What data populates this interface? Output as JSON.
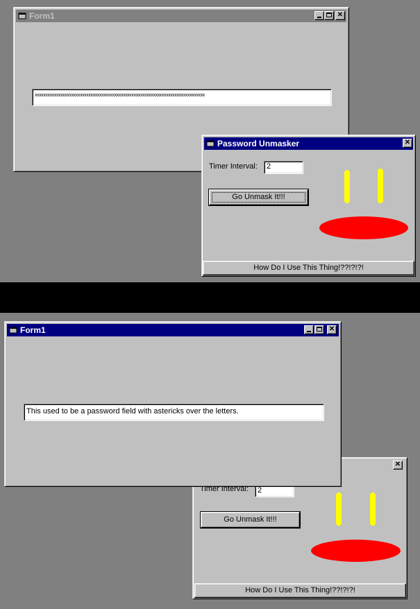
{
  "top_scene": {
    "form1": {
      "title": "Form1",
      "textbox_value": "xxxxxxxxxxxxxxxxxxxxxxxxxxxxxxxxxxxxxxxxxxxxxxxxxxxxxxxxxxxxxxxxxxxxxxxxxxxxxxx",
      "icons": {
        "app": "window-icon",
        "minimize": "minimize-icon",
        "maximize": "maximize-icon",
        "close": "close-icon"
      }
    },
    "unmasker": {
      "title": "Password Unmasker",
      "timer_label": "Timer Interval:",
      "timer_value": "2",
      "go_button": "Go Unmask It!!!",
      "help_button": "How Do I Use This Thing!??!?!?!",
      "close_icon": "close-icon"
    }
  },
  "bottom_scene": {
    "form1": {
      "title": "Form1",
      "textbox_value": "This used to be a password field with astericks over the letters.",
      "icons": {
        "app": "window-icon",
        "minimize": "minimize-icon",
        "maximize": "maximize-icon",
        "close": "close-icon"
      }
    },
    "unmasker": {
      "timer_label": "Timer Interval:",
      "timer_value": "2",
      "go_button": "Go Unmask It!!!",
      "help_button": "How Do I Use This Thing!??!?!?!",
      "close_icon": "close-icon"
    }
  },
  "colors": {
    "desktop": "#808080",
    "window_face": "#c0c0c0",
    "active_title": "#000080",
    "inactive_title": "#808080",
    "face_eyes": "#ffff00",
    "face_mouth": "#ff0000"
  }
}
